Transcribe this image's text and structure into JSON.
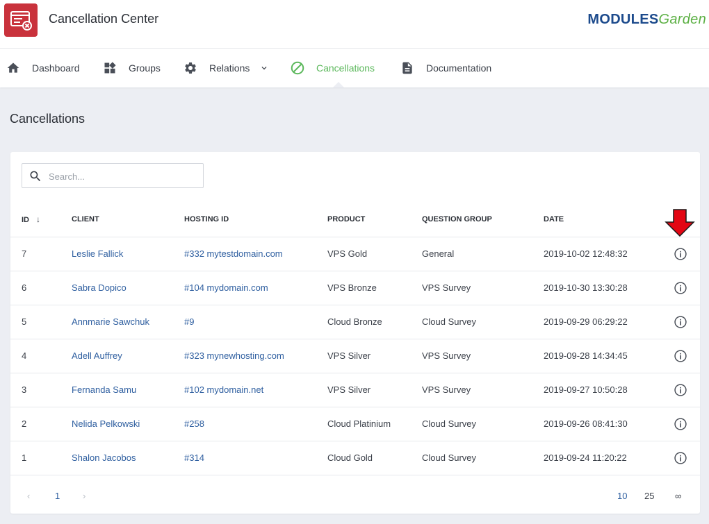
{
  "app": {
    "title": "Cancellation Center",
    "brand_part1": "MODULES",
    "brand_part2": "Garden"
  },
  "nav": [
    {
      "label": "Dashboard",
      "icon": "home-icon"
    },
    {
      "label": "Groups",
      "icon": "widgets-icon"
    },
    {
      "label": "Relations",
      "icon": "gear-icon",
      "dropdown": true
    },
    {
      "label": "Cancellations",
      "icon": "block-icon",
      "active": true
    },
    {
      "label": "Documentation",
      "icon": "document-icon"
    }
  ],
  "page": {
    "title": "Cancellations"
  },
  "search": {
    "placeholder": "Search..."
  },
  "table": {
    "headers": {
      "id": "ID",
      "client": "CLIENT",
      "hosting_id": "HOSTING ID",
      "product": "PRODUCT",
      "question_group": "QUESTION GROUP",
      "date": "DATE"
    },
    "rows": [
      {
        "id": "7",
        "client": "Leslie Fallick",
        "hosting": "#332 mytestdomain.com",
        "product": "VPS Gold",
        "group": "General",
        "date": "2019-10-02 12:48:32"
      },
      {
        "id": "6",
        "client": "Sabra Dopico",
        "hosting": "#104 mydomain.com",
        "product": "VPS Bronze",
        "group": "VPS Survey",
        "date": "2019-10-30 13:30:28"
      },
      {
        "id": "5",
        "client": "Annmarie Sawchuk",
        "hosting": "#9",
        "product": "Cloud Bronze",
        "group": "Cloud Survey",
        "date": "2019-09-29 06:29:22"
      },
      {
        "id": "4",
        "client": "Adell Auffrey",
        "hosting": "#323 mynewhosting.com",
        "product": "VPS Silver",
        "group": "VPS Survey",
        "date": "2019-09-28 14:34:45"
      },
      {
        "id": "3",
        "client": "Fernanda Samu",
        "hosting": "#102 mydomain.net",
        "product": "VPS Silver",
        "group": "VPS Survey",
        "date": "2019-09-27 10:50:28"
      },
      {
        "id": "2",
        "client": "Nelida Pelkowski",
        "hosting": "#258",
        "product": "Cloud Platinium",
        "group": "Cloud Survey",
        "date": "2019-09-26 08:41:30"
      },
      {
        "id": "1",
        "client": "Shalon Jacobos",
        "hosting": "#314",
        "product": "Cloud Gold",
        "group": "Cloud Survey",
        "date": "2019-09-24 11:20:22"
      }
    ]
  },
  "pagination": {
    "prev": "‹",
    "current": "1",
    "next": "›",
    "sizes": [
      "10",
      "25",
      "∞"
    ],
    "selected_size": "10"
  },
  "colors": {
    "accent": "#5cb85c",
    "link": "#2f5fa0",
    "logo_bg": "#c9323c",
    "annotation_arrow": "#e30613"
  }
}
